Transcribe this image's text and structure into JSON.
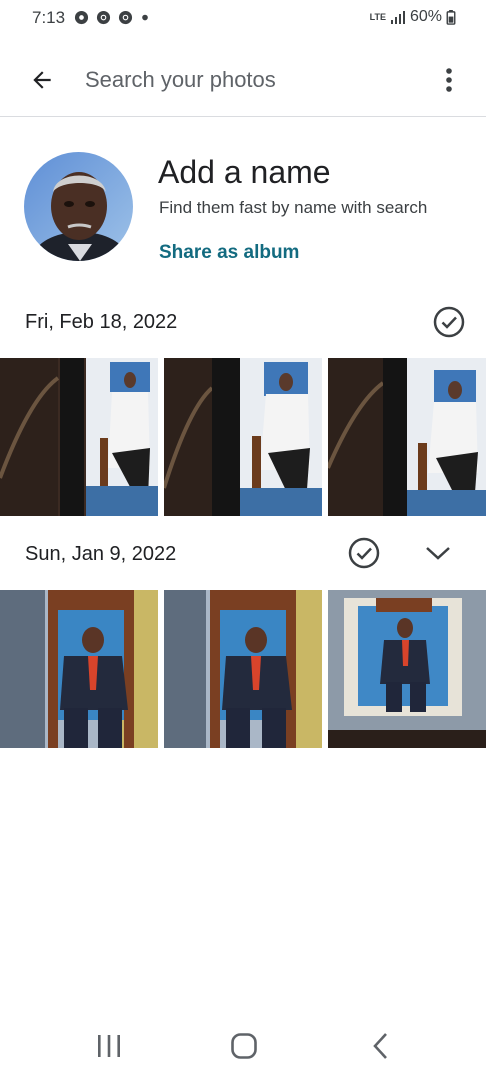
{
  "status_bar": {
    "time": "7:13",
    "network": "LTE",
    "battery": "60%"
  },
  "app_bar": {
    "search_placeholder": "Search your photos"
  },
  "person": {
    "title": "Add a name",
    "subtitle": "Find them fast by name with search",
    "share_label": "Share as album"
  },
  "groups": [
    {
      "date": "Fri, Feb 18, 2022"
    },
    {
      "date": "Sun, Jan 9, 2022"
    }
  ],
  "colors": {
    "accent": "#136b80",
    "text": "#202124",
    "divider": "#dadce0"
  },
  "icons": [
    "back-arrow-icon",
    "more-vert-icon",
    "check-circle-icon",
    "chevron-down-icon",
    "recent-apps-icon",
    "home-icon",
    "nav-back-icon"
  ]
}
